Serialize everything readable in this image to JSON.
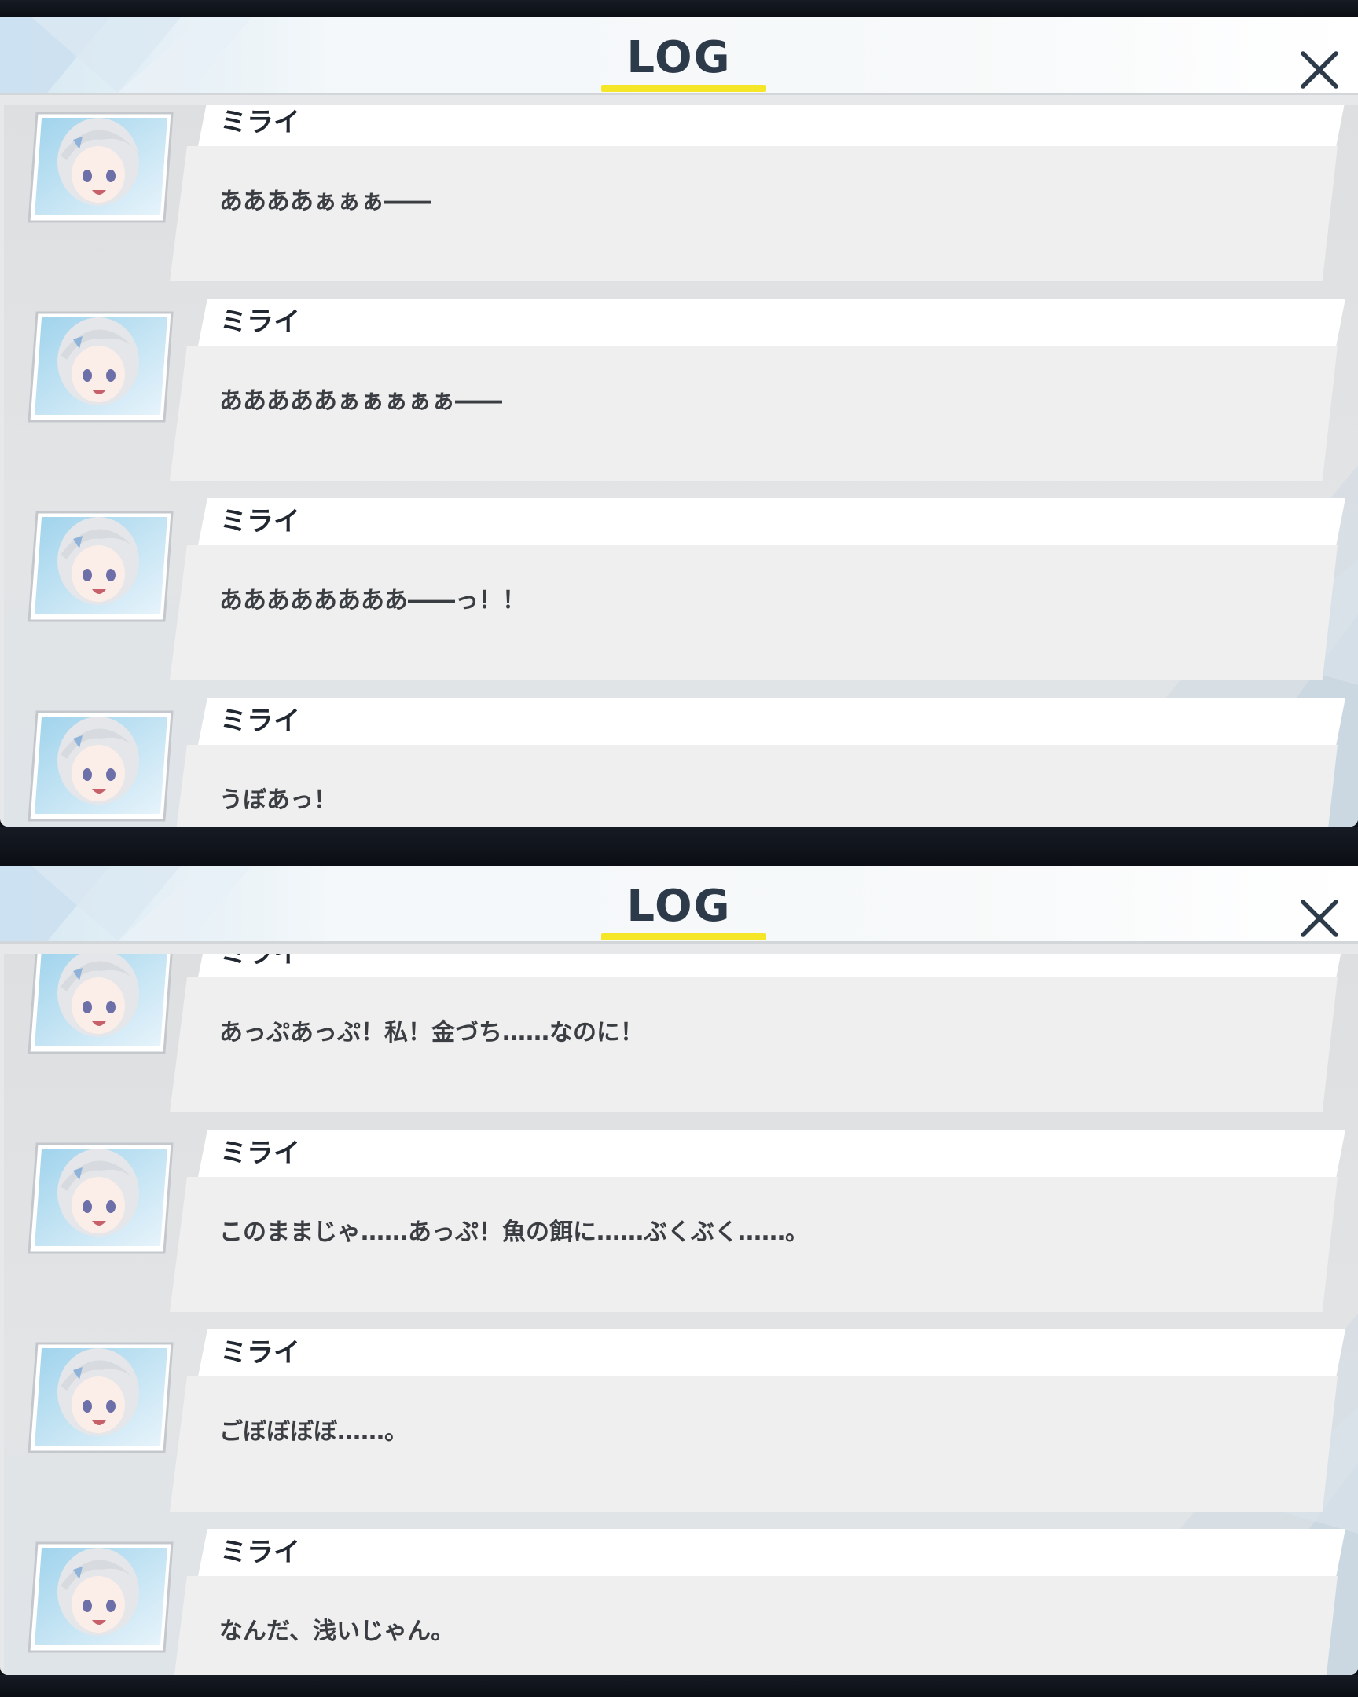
{
  "panels": [
    {
      "title": "LOG",
      "entries": [
        {
          "name": "ミライ",
          "text": "ああああぁぁぁ――"
        },
        {
          "name": "ミライ",
          "text": "あああああぁぁぁぁぁ――"
        },
        {
          "name": "ミライ",
          "text": "ああああああああ――っ！！"
        },
        {
          "name": "ミライ",
          "text": "うぼあっ！"
        }
      ]
    },
    {
      "title": "LOG",
      "entries": [
        {
          "name": "ミライ",
          "text": "あっぷあっぷ！私！金づち……なのに！"
        },
        {
          "name": "ミライ",
          "text": "このままじゃ……あっぷ！魚の餌に……ぶくぶく……。"
        },
        {
          "name": "ミライ",
          "text": "ごぼぼぼぼ……。"
        },
        {
          "name": "ミライ",
          "text": "なんだ、浅いじゃん。"
        }
      ]
    }
  ],
  "icons": {
    "close": "close-icon",
    "avatar": "character-portrait-mirai"
  },
  "colors": {
    "title": "#2d3a4a",
    "underline": "#f5e628",
    "name_strip": "#ffffff",
    "message_box": "#efefef",
    "panel_body": "#e2e4e6"
  }
}
